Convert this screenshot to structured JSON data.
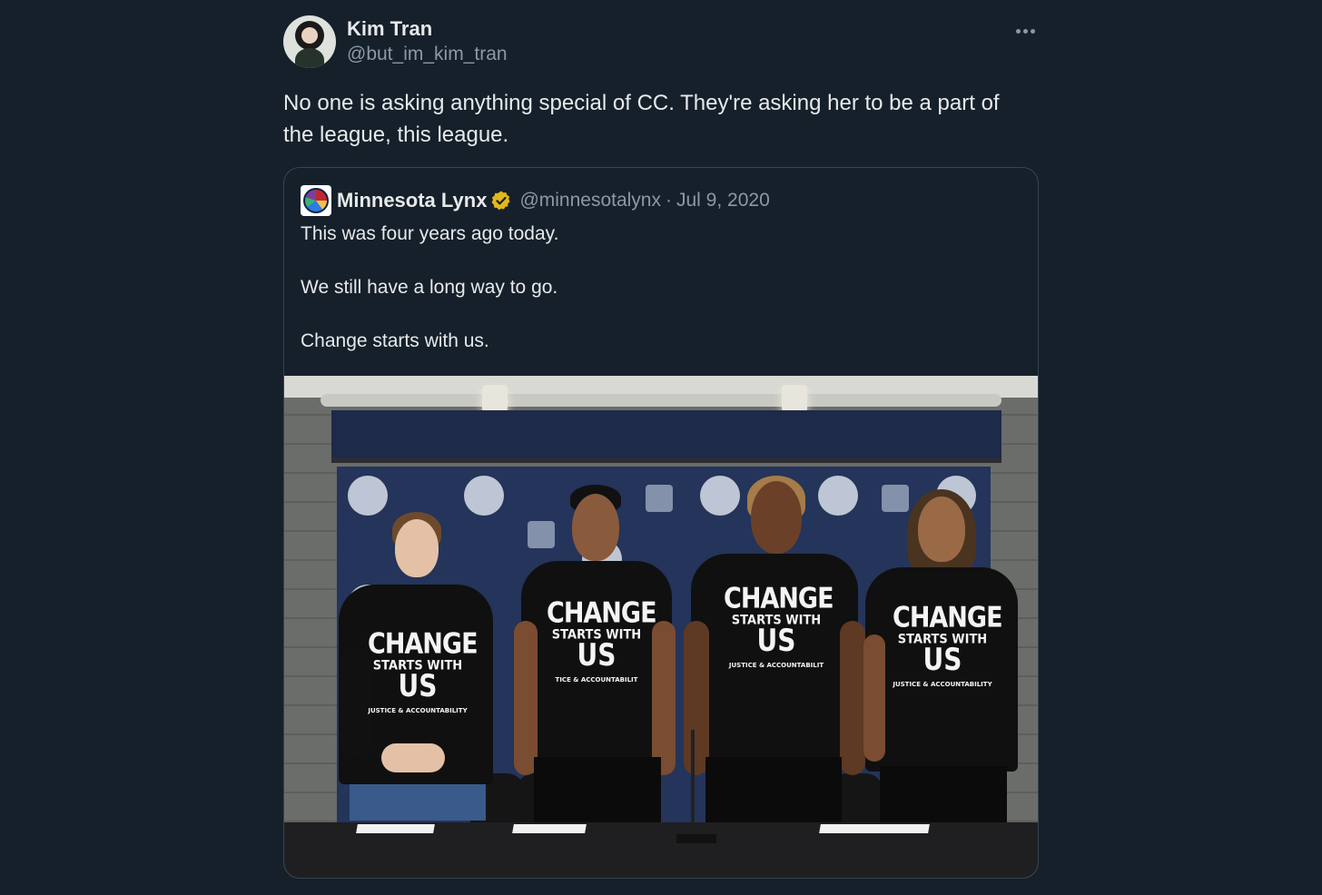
{
  "tweet": {
    "author": {
      "display_name": "Kim Tran",
      "handle": "@but_im_kim_tran"
    },
    "more_icon": "ellipsis-icon",
    "text": "No one is asking anything special of CC. They're asking her to be a part of the league, this league."
  },
  "quote": {
    "author": {
      "display_name": "Minnesota Lynx",
      "handle": "@minnesotalynx",
      "verified_icon": "verified-badge-icon",
      "verified_color": "#e2b719"
    },
    "separator": "·",
    "date": "Jul 9, 2020",
    "lines": [
      "This was four years ago today.",
      "We still have a long way to go.",
      "Change starts with us."
    ],
    "photo": {
      "shirts": [
        {
          "line1": "CHANGE",
          "line2": "STARTS WITH",
          "line3": "US",
          "line4": "JUSTICE & ACCOUNTABILITY"
        },
        {
          "line1": "CHANGE",
          "line2": "STARTS WITH",
          "line3": "US",
          "line4": "TICE & ACCOUNTABILIT"
        },
        {
          "line1": "CHANGE",
          "line2": "STARTS WITH",
          "line3": "US",
          "line4": "JUSTICE & ACCOUNTABILIT"
        },
        {
          "line1": "CHANGE",
          "line2": "STARTS WITH",
          "line3": "US",
          "line4": "JUSTICE & ACCOUNTABILITY"
        }
      ]
    }
  },
  "colors": {
    "background": "#15202b",
    "text_primary": "#e7e9ea",
    "text_secondary": "#8b98a5",
    "border": "#38444d"
  }
}
